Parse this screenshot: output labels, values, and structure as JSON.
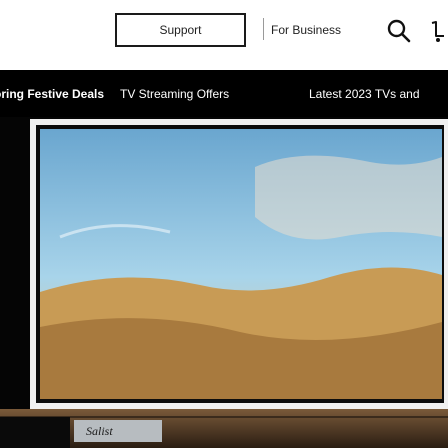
{
  "header": {
    "support_label": "Support",
    "business_label": "For Business",
    "icons": {
      "search": "search-icon",
      "cart": "cart-icon"
    }
  },
  "nav": {
    "items": [
      {
        "label": "oring Festive Deals"
      },
      {
        "label": "TV Streaming Offers"
      },
      {
        "label": "Latest 2023 TVs and"
      }
    ]
  },
  "hero": {
    "logo_text": "Salist",
    "colors": {
      "sky": "#8cc4e0",
      "sand": "#cfa35c"
    }
  }
}
